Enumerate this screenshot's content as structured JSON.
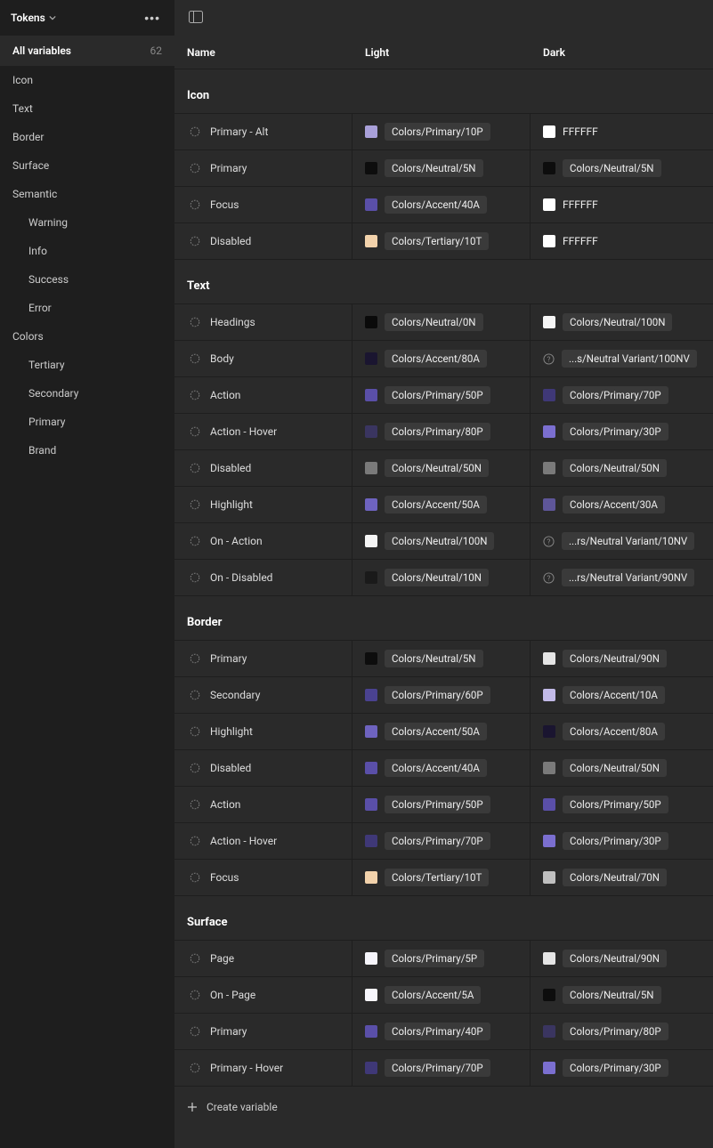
{
  "sidebar": {
    "title": "Tokens",
    "section": {
      "label": "All variables",
      "count": 62
    },
    "items": [
      "Icon",
      "Text",
      "Border",
      "Surface",
      "Semantic"
    ],
    "semantic_children": [
      "Warning",
      "Info",
      "Success",
      "Error"
    ],
    "colors_label": "Colors",
    "colors_children": [
      "Tertiary",
      "Secondary",
      "Primary",
      "Brand"
    ]
  },
  "header": {
    "name": "Name",
    "light": "Light",
    "dark": "Dark"
  },
  "footer": {
    "create": "Create variable"
  },
  "groups": [
    {
      "title": "Icon",
      "rows": [
        {
          "name": "Primary - Alt",
          "light": {
            "sw": "#a9a0d9",
            "chip": "Colors/Primary/10P"
          },
          "dark": {
            "sw": "#ffffff",
            "plain": "FFFFFF"
          }
        },
        {
          "name": "Primary",
          "light": {
            "sw": "#0d0d0d",
            "chip": "Colors/Neutral/5N"
          },
          "dark": {
            "sw": "#0d0d0d",
            "chip": "Colors/Neutral/5N"
          }
        },
        {
          "name": "Focus",
          "light": {
            "sw": "#5a4fa8",
            "chip": "Colors/Accent/40A"
          },
          "dark": {
            "sw": "#ffffff",
            "plain": "FFFFFF"
          }
        },
        {
          "name": "Disabled",
          "light": {
            "sw": "#f2d2ab",
            "chip": "Colors/Tertiary/10T"
          },
          "dark": {
            "sw": "#ffffff",
            "plain": "FFFFFF"
          }
        }
      ]
    },
    {
      "title": "Text",
      "rows": [
        {
          "name": "Headings",
          "light": {
            "sw": "#0a0a0a",
            "chip": "Colors/Neutral/0N"
          },
          "dark": {
            "sw": "#f5f5f5",
            "chip": "Colors/Neutral/100N"
          }
        },
        {
          "name": "Body",
          "light": {
            "sw": "#1a1530",
            "chip": "Colors/Accent/80A"
          },
          "dark": {
            "info": true,
            "chip": "...s/Neutral Variant/100NV"
          }
        },
        {
          "name": "Action",
          "light": {
            "sw": "#5a4fa8",
            "chip": "Colors/Primary/50P"
          },
          "dark": {
            "sw": "#3f3877",
            "chip": "Colors/Primary/70P"
          }
        },
        {
          "name": "Action - Hover",
          "light": {
            "sw": "#3a3560",
            "chip": "Colors/Primary/80P"
          },
          "dark": {
            "sw": "#7b6fd0",
            "chip": "Colors/Primary/30P"
          }
        },
        {
          "name": "Disabled",
          "light": {
            "sw": "#7a7a7a",
            "chip": "Colors/Neutral/50N"
          },
          "dark": {
            "sw": "#7a7a7a",
            "chip": "Colors/Neutral/50N"
          }
        },
        {
          "name": "Highlight",
          "light": {
            "sw": "#6e63bf",
            "chip": "Colors/Accent/50A"
          },
          "dark": {
            "sw": "#5e5699",
            "chip": "Colors/Accent/30A"
          }
        },
        {
          "name": "On - Action",
          "light": {
            "sw": "#f5f5f5",
            "chip": "Colors/Neutral/100N"
          },
          "dark": {
            "info": true,
            "chip": "...rs/Neutral Variant/10NV"
          }
        },
        {
          "name": "On - Disabled",
          "light": {
            "sw": "#1a1a1a",
            "chip": "Colors/Neutral/10N"
          },
          "dark": {
            "info": true,
            "chip": "...rs/Neutral Variant/90NV"
          }
        }
      ]
    },
    {
      "title": "Border",
      "rows": [
        {
          "name": "Primary",
          "light": {
            "sw": "#0d0d0d",
            "chip": "Colors/Neutral/5N"
          },
          "dark": {
            "sw": "#e5e5e5",
            "chip": "Colors/Neutral/90N"
          }
        },
        {
          "name": "Secondary",
          "light": {
            "sw": "#4a4290",
            "chip": "Colors/Primary/60P"
          },
          "dark": {
            "sw": "#c2bae8",
            "chip": "Colors/Accent/10A"
          }
        },
        {
          "name": "Highlight",
          "light": {
            "sw": "#6e63bf",
            "chip": "Colors/Accent/50A"
          },
          "dark": {
            "sw": "#1a1530",
            "chip": "Colors/Accent/80A"
          }
        },
        {
          "name": "Disabled",
          "light": {
            "sw": "#5a4fa8",
            "chip": "Colors/Accent/40A"
          },
          "dark": {
            "sw": "#7a7a7a",
            "chip": "Colors/Neutral/50N"
          }
        },
        {
          "name": "Action",
          "light": {
            "sw": "#5a4fa8",
            "chip": "Colors/Primary/50P"
          },
          "dark": {
            "sw": "#5a4fa8",
            "chip": "Colors/Primary/50P"
          }
        },
        {
          "name": "Action - Hover",
          "light": {
            "sw": "#3f3877",
            "chip": "Colors/Primary/70P"
          },
          "dark": {
            "sw": "#7b6fd0",
            "chip": "Colors/Primary/30P"
          }
        },
        {
          "name": "Focus",
          "light": {
            "sw": "#f2d2ab",
            "chip": "Colors/Tertiary/10T"
          },
          "dark": {
            "sw": "#bfbfbf",
            "chip": "Colors/Neutral/70N"
          }
        }
      ]
    },
    {
      "title": "Surface",
      "rows": [
        {
          "name": "Page",
          "light": {
            "sw": "#f6f5fb",
            "chip": "Colors/Primary/5P"
          },
          "dark": {
            "sw": "#e5e5e5",
            "chip": "Colors/Neutral/90N"
          }
        },
        {
          "name": "On - Page",
          "light": {
            "sw": "#f7f6fc",
            "chip": "Colors/Accent/5A"
          },
          "dark": {
            "sw": "#0d0d0d",
            "chip": "Colors/Neutral/5N"
          }
        },
        {
          "name": "Primary",
          "light": {
            "sw": "#5a4fa8",
            "chip": "Colors/Primary/40P"
          },
          "dark": {
            "sw": "#3a3560",
            "chip": "Colors/Primary/80P"
          }
        },
        {
          "name": "Primary - Hover",
          "light": {
            "sw": "#3f3877",
            "chip": "Colors/Primary/70P"
          },
          "dark": {
            "sw": "#7b6fd0",
            "chip": "Colors/Primary/30P"
          }
        }
      ]
    }
  ]
}
